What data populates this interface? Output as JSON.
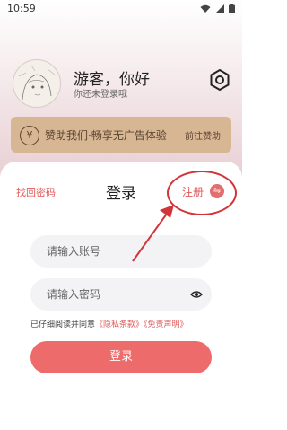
{
  "status_bar": {
    "time": "10:59"
  },
  "profile": {
    "username": "游客，你好",
    "subtitle": "你还未登录哦"
  },
  "sponsor": {
    "icon_symbol": "¥",
    "text": "赞助我们·畅享无广告体验",
    "link": "前往赞助"
  },
  "login_sheet": {
    "forgot_password": "找回密码",
    "title": "登录",
    "register": "注册",
    "register_icon_symbol": "⇋",
    "account_placeholder": "请输入账号",
    "password_placeholder": "请输入密码",
    "agreement_prefix": "已仔细阅读并同意",
    "privacy_link": "《隐私条款》",
    "disclaimer_link": "《免责声明》",
    "login_button": "登录"
  },
  "colors": {
    "accent": "#ee6b6b",
    "annotation": "#d3343a",
    "sponsor_bg": "#d6b693"
  }
}
